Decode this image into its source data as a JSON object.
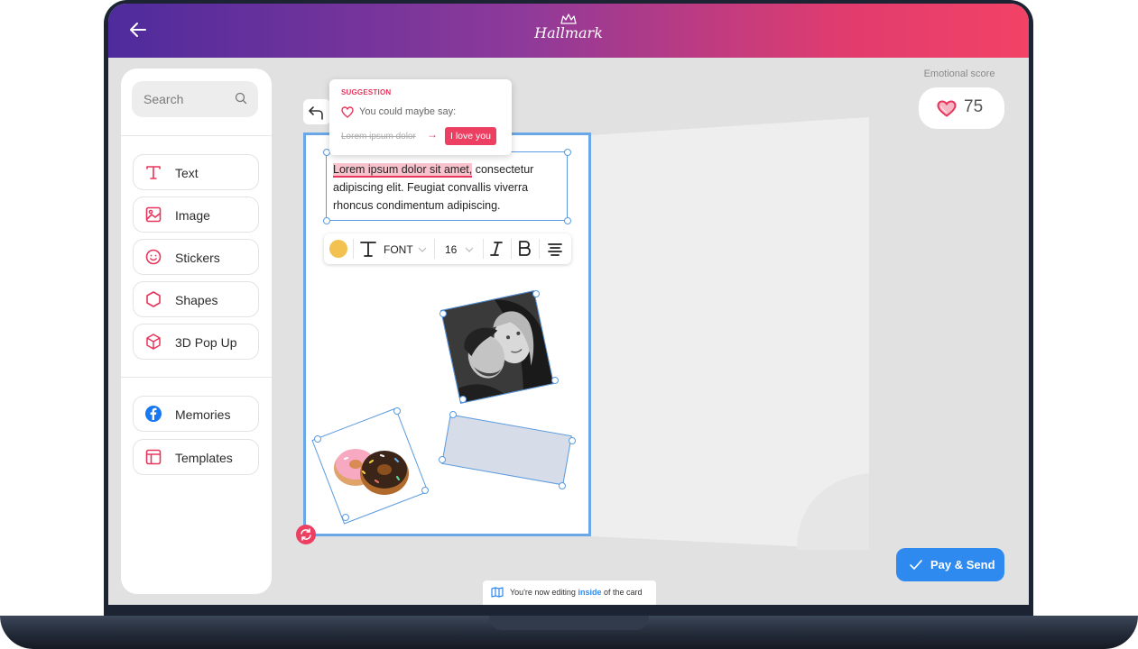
{
  "header": {
    "brand": "Hallmark",
    "back_icon": "arrow-left-icon"
  },
  "sidebar": {
    "search_placeholder": "Search",
    "tools": [
      {
        "label": "Text",
        "icon": "text-t-icon"
      },
      {
        "label": "Image",
        "icon": "image-icon"
      },
      {
        "label": "Stickers",
        "icon": "smiley-icon"
      },
      {
        "label": "Shapes",
        "icon": "hexagon-icon"
      },
      {
        "label": "3D Pop Up",
        "icon": "cube-icon"
      }
    ],
    "extras": [
      {
        "label": "Memories",
        "icon": "facebook-icon"
      },
      {
        "label": "Templates",
        "icon": "template-layout-icon"
      }
    ]
  },
  "suggestion": {
    "title": "SUGGESTION",
    "prompt": "You could maybe say:",
    "original": "Lorem ipsum dolor",
    "replacement": "I love you"
  },
  "card": {
    "highlighted_text": "Lorem ipsum dolor sit amet,",
    "body_text": " consectetur adipiscing elit. Feugiat convallis viverra rhoncus condimentum adipiscing."
  },
  "format_bar": {
    "color": "#F3C150",
    "font_label": "FONT",
    "size": "16"
  },
  "emotional_score": {
    "label": "Emotional score",
    "value": "75"
  },
  "pay_button": {
    "label": "Pay & Send"
  },
  "hint": {
    "prefix": "You're now editing ",
    "emphasis": "inside",
    "suffix": " of the card"
  },
  "colors": {
    "accent_pink": "#EC3F62",
    "primary_blue": "#2F8AF0",
    "selection_blue": "#5B9BE0",
    "header_gradient_start": "#4E2B9C",
    "header_gradient_end": "#F24266"
  }
}
